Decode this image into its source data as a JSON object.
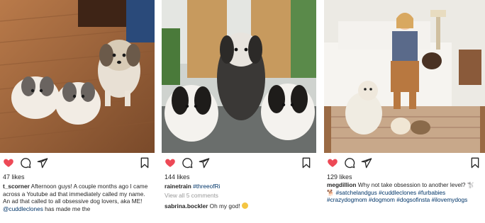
{
  "colors": {
    "heart": "#ed4956",
    "icon": "#262626",
    "hashtag": "#003569",
    "muted": "#999999"
  },
  "posts": [
    {
      "likes": "47 likes",
      "username": "t_scorner",
      "caption_parts": [
        {
          "t": "text",
          "v": " Afternoon guys! A couple months ago I came across a Youtube ad that immediately called my name. An ad that called to all obsessive dog lovers, aka ME! "
        },
        {
          "t": "tag",
          "v": "@cuddleclones"
        },
        {
          "t": "text",
          "v": " has made me the"
        }
      ],
      "icons": [
        "heart-filled-icon",
        "comment-icon",
        "share-icon",
        "bookmark-icon"
      ]
    },
    {
      "likes": "144 likes",
      "username": "rainetrain",
      "caption_parts": [
        {
          "t": "tag",
          "v": " #threeofRi"
        }
      ],
      "view_comments": "View all 5 comments",
      "comment_user": "sabrina.bockler",
      "comment_text": " Oh my god! ",
      "icons": [
        "heart-filled-icon",
        "comment-icon",
        "share-icon",
        "bookmark-icon"
      ]
    },
    {
      "likes": "129 likes",
      "username": "megdillion",
      "caption_parts": [
        {
          "t": "text",
          "v": " Why not take obsession to another level? 🐩🐕 "
        },
        {
          "t": "tag",
          "v": "#satchelandgus #cuddleclones #furbabies #crazydogmom #dogmom #dogsofinsta #ilovemydogs"
        }
      ],
      "icons": [
        "heart-filled-icon",
        "comment-icon",
        "share-icon",
        "bookmark-icon"
      ]
    }
  ]
}
